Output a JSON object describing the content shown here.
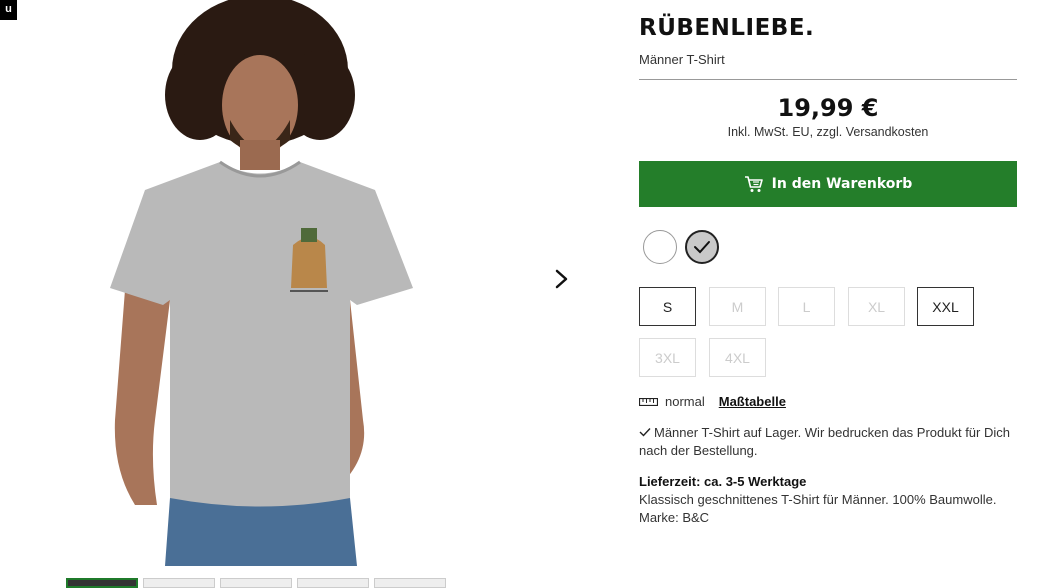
{
  "corner_badge": "u",
  "product": {
    "brand": "RÜBENLIEBE.",
    "subtitle": "Männer T-Shirt",
    "price": "19,99 €",
    "price_note": "Inkl. MwSt. EU, zzgl. Versandkosten",
    "add_to_cart_label": "In den Warenkorb"
  },
  "colors": {
    "accent": "#247e2a",
    "swatches": [
      {
        "name": "white",
        "hex": "#ffffff",
        "selected": false
      },
      {
        "name": "grey",
        "hex": "#c9c9c9",
        "selected": true
      }
    ]
  },
  "sizes": [
    {
      "label": "S",
      "available": true
    },
    {
      "label": "M",
      "available": false
    },
    {
      "label": "L",
      "available": false
    },
    {
      "label": "XL",
      "available": false
    },
    {
      "label": "XXL",
      "available": true
    },
    {
      "label": "3XL",
      "available": false
    },
    {
      "label": "4XL",
      "available": false
    }
  ],
  "fit": {
    "label": "normal",
    "size_chart_link": "Maßtabelle"
  },
  "stock_text": "Männer T-Shirt auf Lager. Wir bedrucken das Produkt für Dich nach der Bestellung.",
  "delivery": {
    "title": "Lieferzeit: ca. 3-5 Werktage",
    "description": "Klassisch geschnittenes T-Shirt für Männer. 100% Baumwolle. Marke: B&C"
  },
  "icons": [
    "cart-icon",
    "check-icon",
    "ruler-icon",
    "chevron-right-icon"
  ]
}
